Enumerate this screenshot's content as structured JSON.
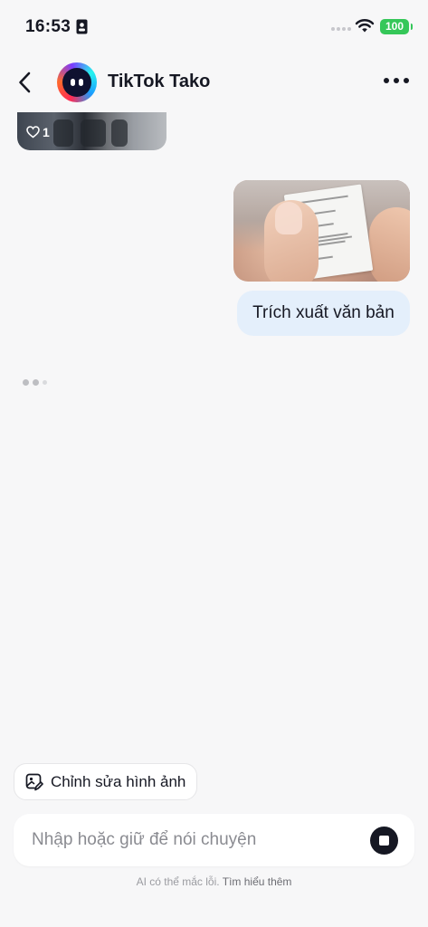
{
  "status_bar": {
    "time": "16:53",
    "battery": "100",
    "battery_color": "#35c759"
  },
  "header": {
    "title": "TikTok Tako",
    "back_icon": "chevron-left-icon",
    "more_icon": "more-horizontal-icon"
  },
  "chat": {
    "previous_image": {
      "likes": "1"
    },
    "user_message": "Trích xuất văn bản",
    "user_bubble_color": "#e4effb"
  },
  "composer": {
    "edit_chip_label": "Chỉnh sửa hình ảnh",
    "placeholder": "Nhập hoặc giữ để nói chuyện",
    "stop_icon": "stop-icon"
  },
  "footer": {
    "disclaimer": "AI có thể mắc lỗi.",
    "learn_more": "Tìm hiểu thêm"
  }
}
